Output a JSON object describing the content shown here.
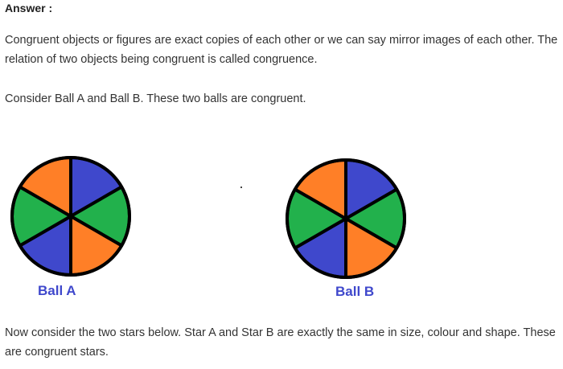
{
  "heading": "Answer :",
  "paragraphs": {
    "p1": "Congruent objects or figures are exact copies of each other or we can say mirror images of each other. The relation of two objects being congruent is called congruence.",
    "p2": "Consider Ball A and Ball B. These two balls are congruent.",
    "p3": "Now consider the two stars below. Star A and Star B are exactly the same in size, colour and shape. These are congruent stars."
  },
  "balls": {
    "a": {
      "label": "Ball A",
      "segments": [
        "#3f48cc",
        "#22b14c",
        "#ff7f27",
        "#3f48cc",
        "#22b14c",
        "#ff7f27"
      ]
    },
    "b": {
      "label": "Ball B",
      "segments": [
        "#3f48cc",
        "#22b14c",
        "#ff7f27",
        "#3f48cc",
        "#22b14c",
        "#ff7f27"
      ]
    }
  },
  "colors": {
    "blue": "#3f48cc",
    "green": "#22b14c",
    "orange": "#ff7f27",
    "label": "#3f48cc"
  }
}
